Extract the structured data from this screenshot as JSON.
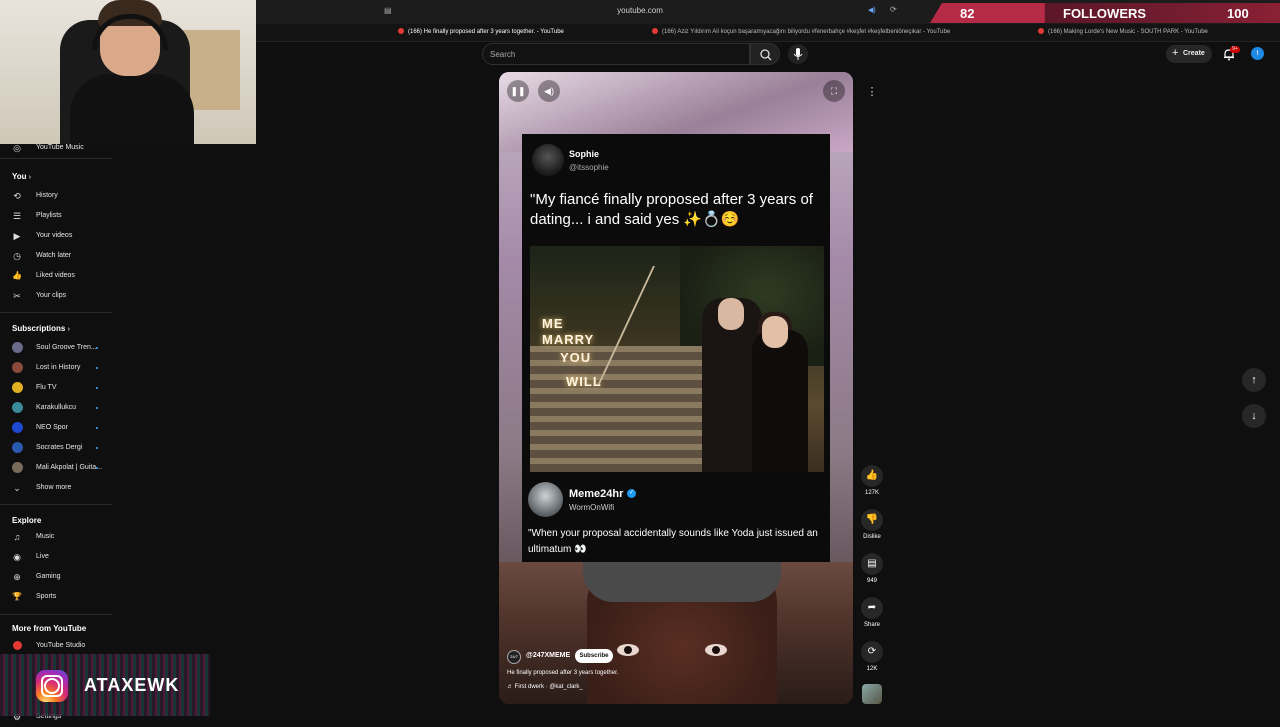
{
  "browser": {
    "url": "youtube.com",
    "tabs": [
      {
        "label": "(166) He finally proposed after 3 years together. - YouTube",
        "active": true
      },
      {
        "label": "(166) Aziz Yıldırım Ali koçun başaramıyacağını biliyordu #fenerbahçe #keşfet #keşfetbeniöneçıkar - YouTube",
        "active": false
      },
      {
        "label": "(166) Making Lorde's New Music - SOUTH PARK - YouTube",
        "active": false
      }
    ]
  },
  "overlay": {
    "followers_current": "82",
    "followers_label": "FOLLOWERS",
    "followers_goal": "100",
    "followers_progress": 0.82,
    "instagram_handle": "ATAXEWK"
  },
  "header": {
    "search_placeholder": "Search",
    "create_label": "Create",
    "notifications_badge": "9+",
    "avatar_letter": "t"
  },
  "sidebar": {
    "youtube_music": "YouTube Music",
    "you_title": "You",
    "you_items": [
      {
        "label": "History",
        "icon": "history-icon",
        "glyph": "⟲"
      },
      {
        "label": "Playlists",
        "icon": "playlists-icon",
        "glyph": "☰"
      },
      {
        "label": "Your videos",
        "icon": "your-videos-icon",
        "glyph": "▶"
      },
      {
        "label": "Watch later",
        "icon": "watch-later-icon",
        "glyph": "◷"
      },
      {
        "label": "Liked videos",
        "icon": "like-icon",
        "glyph": "👍"
      },
      {
        "label": "Your clips",
        "icon": "clips-icon",
        "glyph": "✂"
      }
    ],
    "subscriptions_title": "Subscriptions",
    "subscriptions": [
      {
        "label": "Soul Groove Tren...",
        "color": "#6a6a8a"
      },
      {
        "label": "Lost in History",
        "color": "#8a4a3a"
      },
      {
        "label": "Flu TV",
        "color": "#e0b020"
      },
      {
        "label": "Karakullukcu",
        "color": "#3a8a9a"
      },
      {
        "label": "NEO Spor",
        "color": "#1e4ad0"
      },
      {
        "label": "Socrates Dergi",
        "color": "#2a5ab0"
      },
      {
        "label": "Mali Akpolat | Guita...",
        "color": "#7a6a5a"
      }
    ],
    "show_more": "Show more",
    "explore_title": "Explore",
    "explore_items": [
      {
        "label": "Music",
        "icon": "music-icon",
        "glyph": "♫"
      },
      {
        "label": "Live",
        "icon": "live-icon",
        "glyph": "◉"
      },
      {
        "label": "Gaming",
        "icon": "gaming-icon",
        "glyph": "⊕"
      },
      {
        "label": "Sports",
        "icon": "sports-icon",
        "glyph": "🏆"
      }
    ],
    "more_title": "More from YouTube",
    "studio": "YouTube Studio",
    "settings": "Settings"
  },
  "short": {
    "tweet_name": "Sophie",
    "tweet_handle": "@itssophie",
    "tweet_text": "\"My fiancé finally proposed after 3 years of dating... i and said yes ✨💍☺️",
    "sign_lines": [
      "ME",
      "MARRY",
      "YOU",
      "WILL"
    ],
    "meme_name": "Meme24hr",
    "meme_handle": "WormOnWifi",
    "meme_text": "\"When your proposal accidentally sounds like Yoda just issued an ultimatum 👀",
    "channel_avatar": "24/7",
    "channel_name": "@247XMEME",
    "subscribe_label": "Subscribe",
    "title": "He finally proposed after 3 years together.",
    "sound": "♬ First dwerk · @kat_clark_"
  },
  "actions": {
    "likes": "127K",
    "dislike_label": "Dislike",
    "comments": "949",
    "share_label": "Share",
    "remix": "12K"
  }
}
